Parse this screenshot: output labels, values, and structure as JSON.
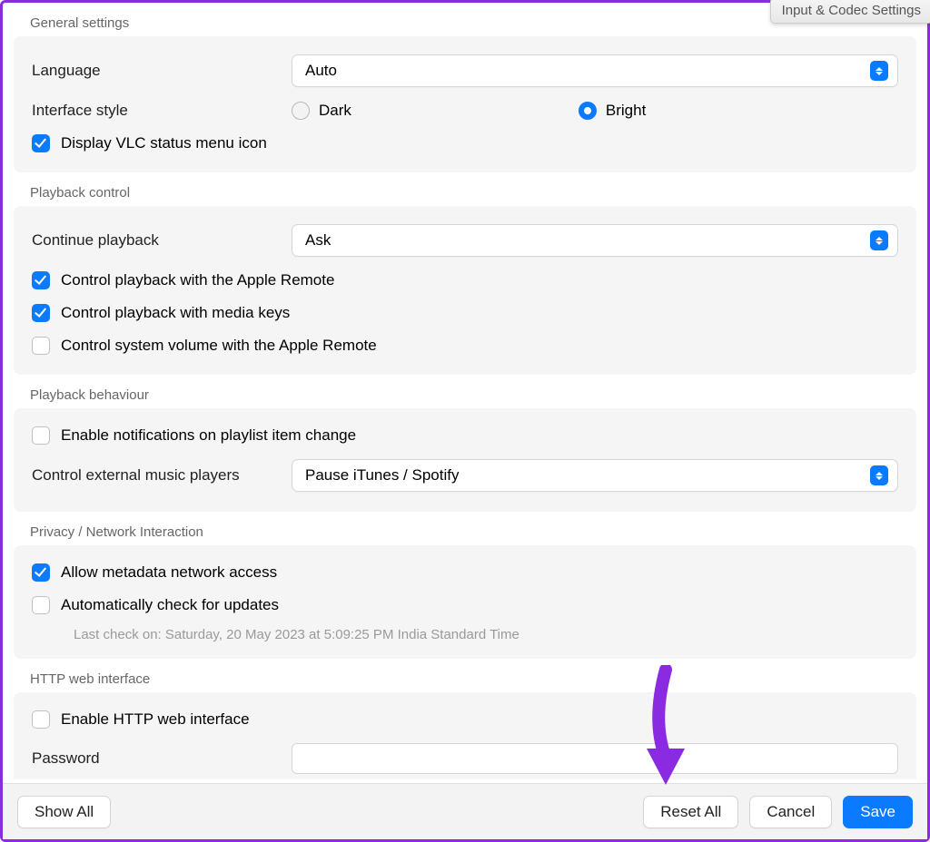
{
  "tooltip": "Input & Codec Settings",
  "sections": {
    "general": {
      "title": "General settings",
      "language_label": "Language",
      "language_value": "Auto",
      "style_label": "Interface style",
      "style_dark": "Dark",
      "style_bright": "Bright",
      "style_selected": "Bright",
      "status_menu_label": "Display VLC status menu icon",
      "status_menu_checked": true
    },
    "playback_control": {
      "title": "Playback control",
      "continue_label": "Continue playback",
      "continue_value": "Ask",
      "apple_remote_label": "Control playback with the Apple Remote",
      "apple_remote_checked": true,
      "media_keys_label": "Control playback with media keys",
      "media_keys_checked": true,
      "sys_volume_label": "Control system volume with the Apple Remote",
      "sys_volume_checked": false
    },
    "playback_behaviour": {
      "title": "Playback behaviour",
      "notifications_label": "Enable notifications on playlist item change",
      "notifications_checked": false,
      "external_label": "Control external music players",
      "external_value": "Pause iTunes / Spotify"
    },
    "privacy": {
      "title": "Privacy / Network Interaction",
      "metadata_label": "Allow metadata network access",
      "metadata_checked": true,
      "updates_label": "Automatically check for updates",
      "updates_checked": false,
      "last_check": "Last check on: Saturday, 20 May 2023 at 5:09:25 PM India Standard Time"
    },
    "http": {
      "title": "HTTP web interface",
      "enable_label": "Enable HTTP web interface",
      "enable_checked": false,
      "password_label": "Password",
      "password_value": ""
    }
  },
  "footer": {
    "show_all": "Show All",
    "reset_all": "Reset All",
    "cancel": "Cancel",
    "save": "Save"
  }
}
